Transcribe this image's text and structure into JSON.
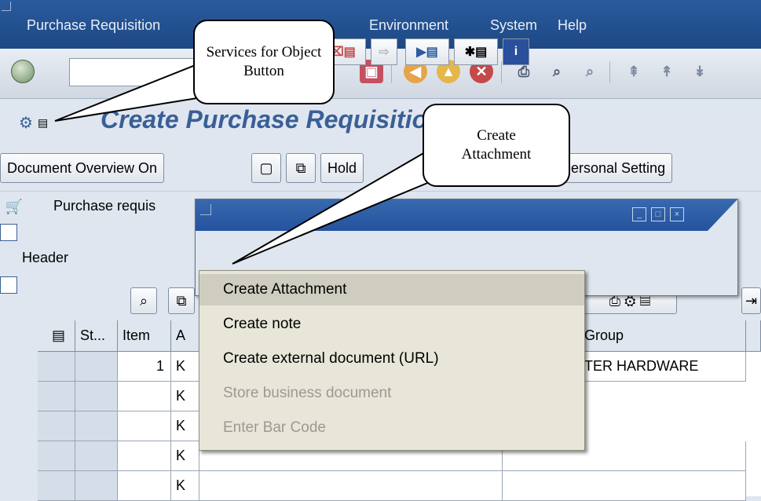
{
  "menu": {
    "items": [
      "Purchase Requisition",
      "Environment",
      "System",
      "Help"
    ]
  },
  "toolbar": {
    "icons": [
      "ok-icon",
      "save-icon",
      "back-icon",
      "exit-icon",
      "cancel-icon",
      "print-icon",
      "find-icon",
      "find-next-icon",
      "first-page-icon",
      "prev-page-icon",
      "next-page-icon"
    ]
  },
  "title": "Create Purchase Requisition",
  "app_toolbar": {
    "document_overview": "Document Overview On",
    "hold": "Hold",
    "personal_setting": "Personal Setting"
  },
  "left_panel": {
    "purchase_req_label": "Purchase requis",
    "header_label": "Header"
  },
  "grid": {
    "headers": [
      "St...",
      "Item",
      "A",
      "Group"
    ],
    "rows": [
      {
        "item": "1",
        "a": "K",
        "group": "TER HARDWARE"
      },
      {
        "item": "",
        "a": "K",
        "group": ""
      },
      {
        "item": "",
        "a": "K",
        "group": ""
      },
      {
        "item": "",
        "a": "K",
        "group": ""
      },
      {
        "item": "",
        "a": "K",
        "group": ""
      }
    ]
  },
  "dropdown": {
    "items": [
      {
        "label": "Create Attachment",
        "enabled": true
      },
      {
        "label": "Create note",
        "enabled": true
      },
      {
        "label": "Create external document (URL)",
        "enabled": true
      },
      {
        "label": "Store business document",
        "enabled": false
      },
      {
        "label": "Enter Bar Code",
        "enabled": false
      }
    ]
  },
  "callouts": {
    "services": "Services for Object Button",
    "attachment": "Create Attachment"
  },
  "colors": {
    "menubar": "#1d4884",
    "title": "#3a5f97",
    "background": "#dfe6ef",
    "dropdown": "#e8e6d8"
  }
}
